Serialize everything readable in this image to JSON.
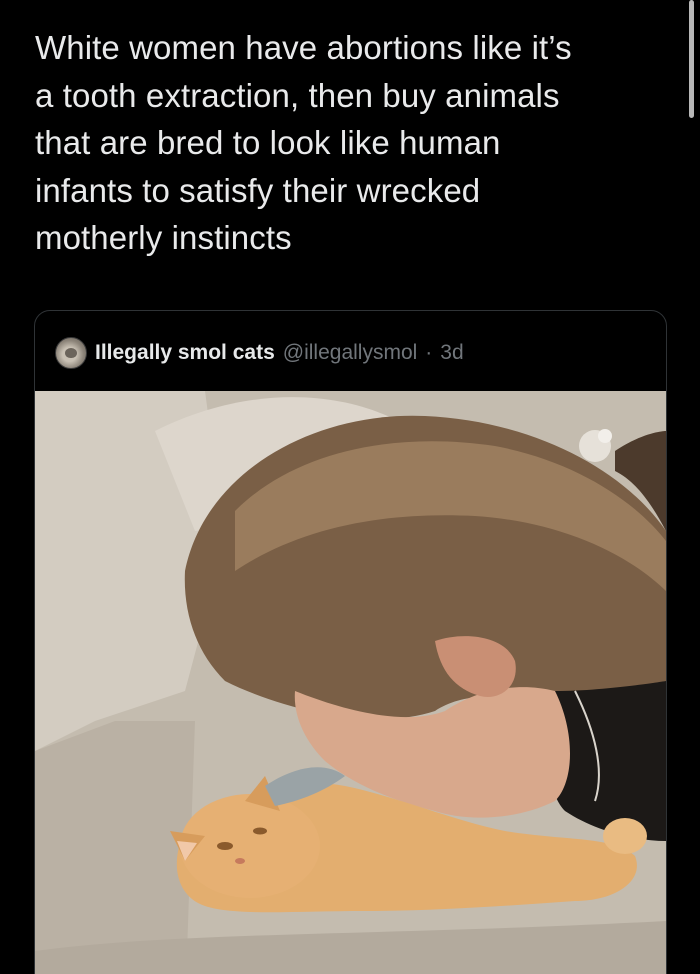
{
  "tweet": {
    "text": "White women have abortions like it’s\na tooth extraction, then buy animals\nthat are bred to look like human\ninfants to satisfy their wrecked\nmotherly instincts"
  },
  "quoted_tweet": {
    "display_name": "Illegally smol cats",
    "handle": "@illegallysmol",
    "separator": "·",
    "age": "3d",
    "avatar_icon": "cat-avatar-icon",
    "media_description_icon": "video-frame-image"
  },
  "colors": {
    "background": "#000000",
    "text_primary": "#e7e9ea",
    "text_secondary": "#71767b",
    "card_border": "#2f3336"
  }
}
